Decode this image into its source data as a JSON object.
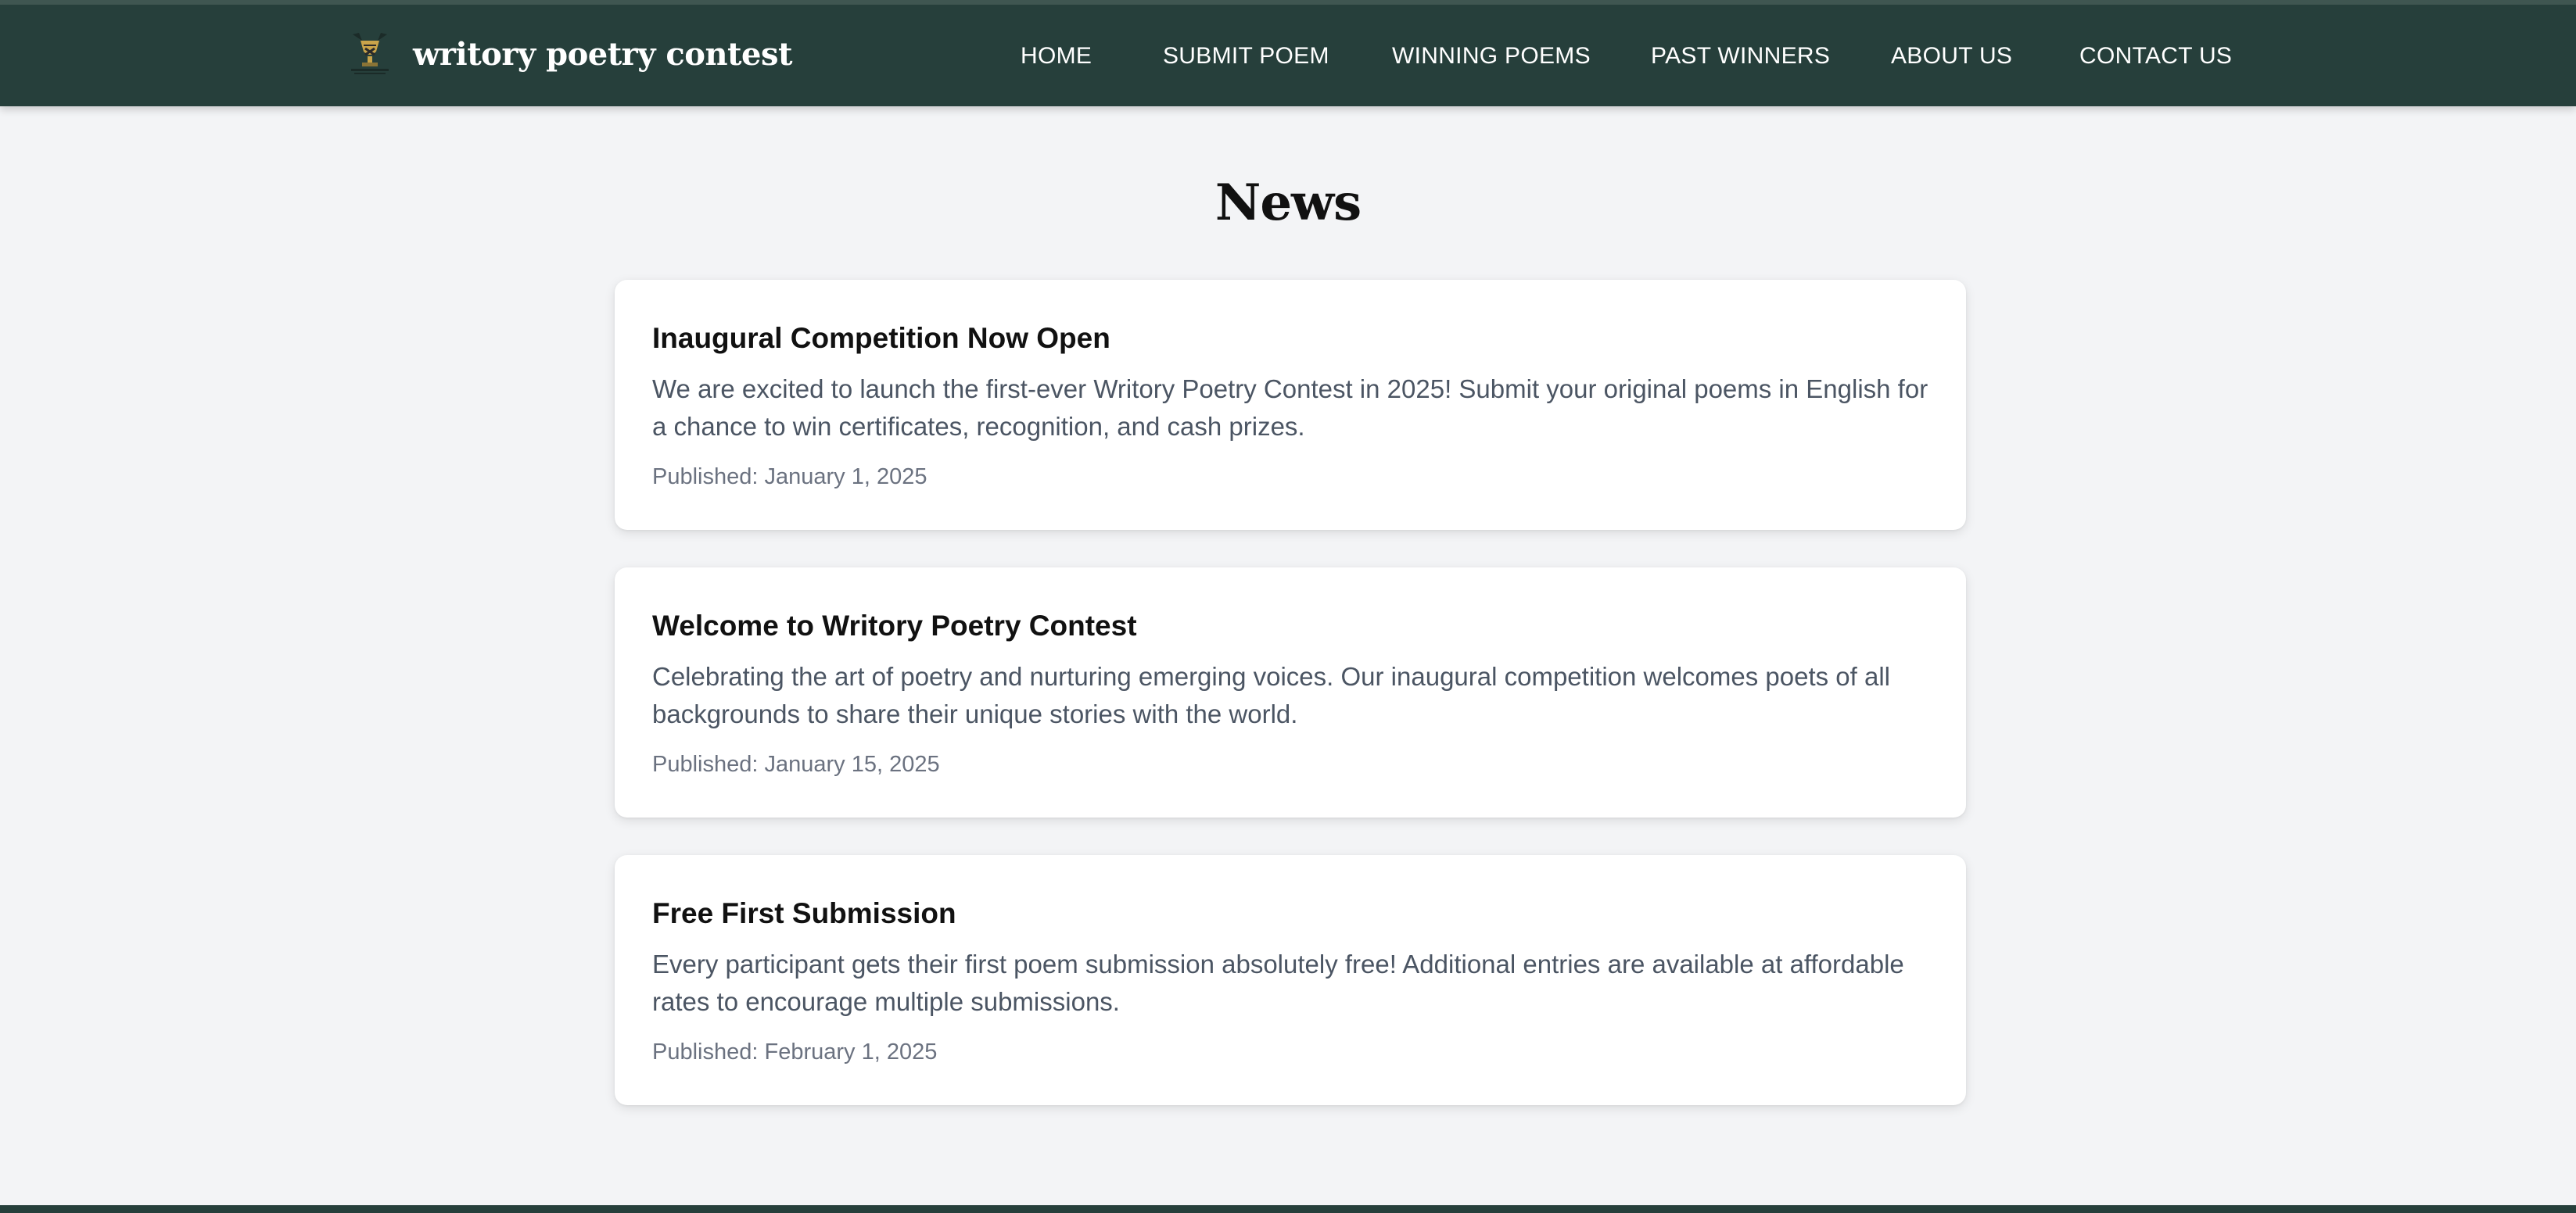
{
  "header": {
    "brand_name": "writory poetry contest",
    "logo_icon": "trophy-logo-icon",
    "nav": [
      {
        "label": "HOME"
      },
      {
        "label": "SUBMIT POEM"
      },
      {
        "label": "WINNING POEMS"
      },
      {
        "label": "PAST WINNERS"
      },
      {
        "label": "ABOUT US"
      },
      {
        "label": "CONTACT US"
      }
    ]
  },
  "main": {
    "title": "News",
    "articles": [
      {
        "title": "Inaugural Competition Now Open",
        "body": "We are excited to launch the first-ever Writory Poetry Contest in 2025! Submit your original poems in English for a chance to win certificates, recognition, and cash prizes.",
        "date": "Published: January 1, 2025"
      },
      {
        "title": "Welcome to Writory Poetry Contest",
        "body": "Celebrating the art of poetry and nurturing emerging voices. Our inaugural competition welcomes poets of all backgrounds to share their unique stories with the world.",
        "date": "Published: January 15, 2025"
      },
      {
        "title": "Free First Submission",
        "body": "Every participant gets their first poem submission absolutely free! Additional entries are available at affordable rates to encourage multiple submissions.",
        "date": "Published: February 1, 2025"
      }
    ]
  },
  "colors": {
    "header_bg": "#263f3b",
    "page_bg": "#f3f4f6",
    "card_bg": "#ffffff",
    "body_text": "#4b5563",
    "muted_text": "#6b7280"
  }
}
